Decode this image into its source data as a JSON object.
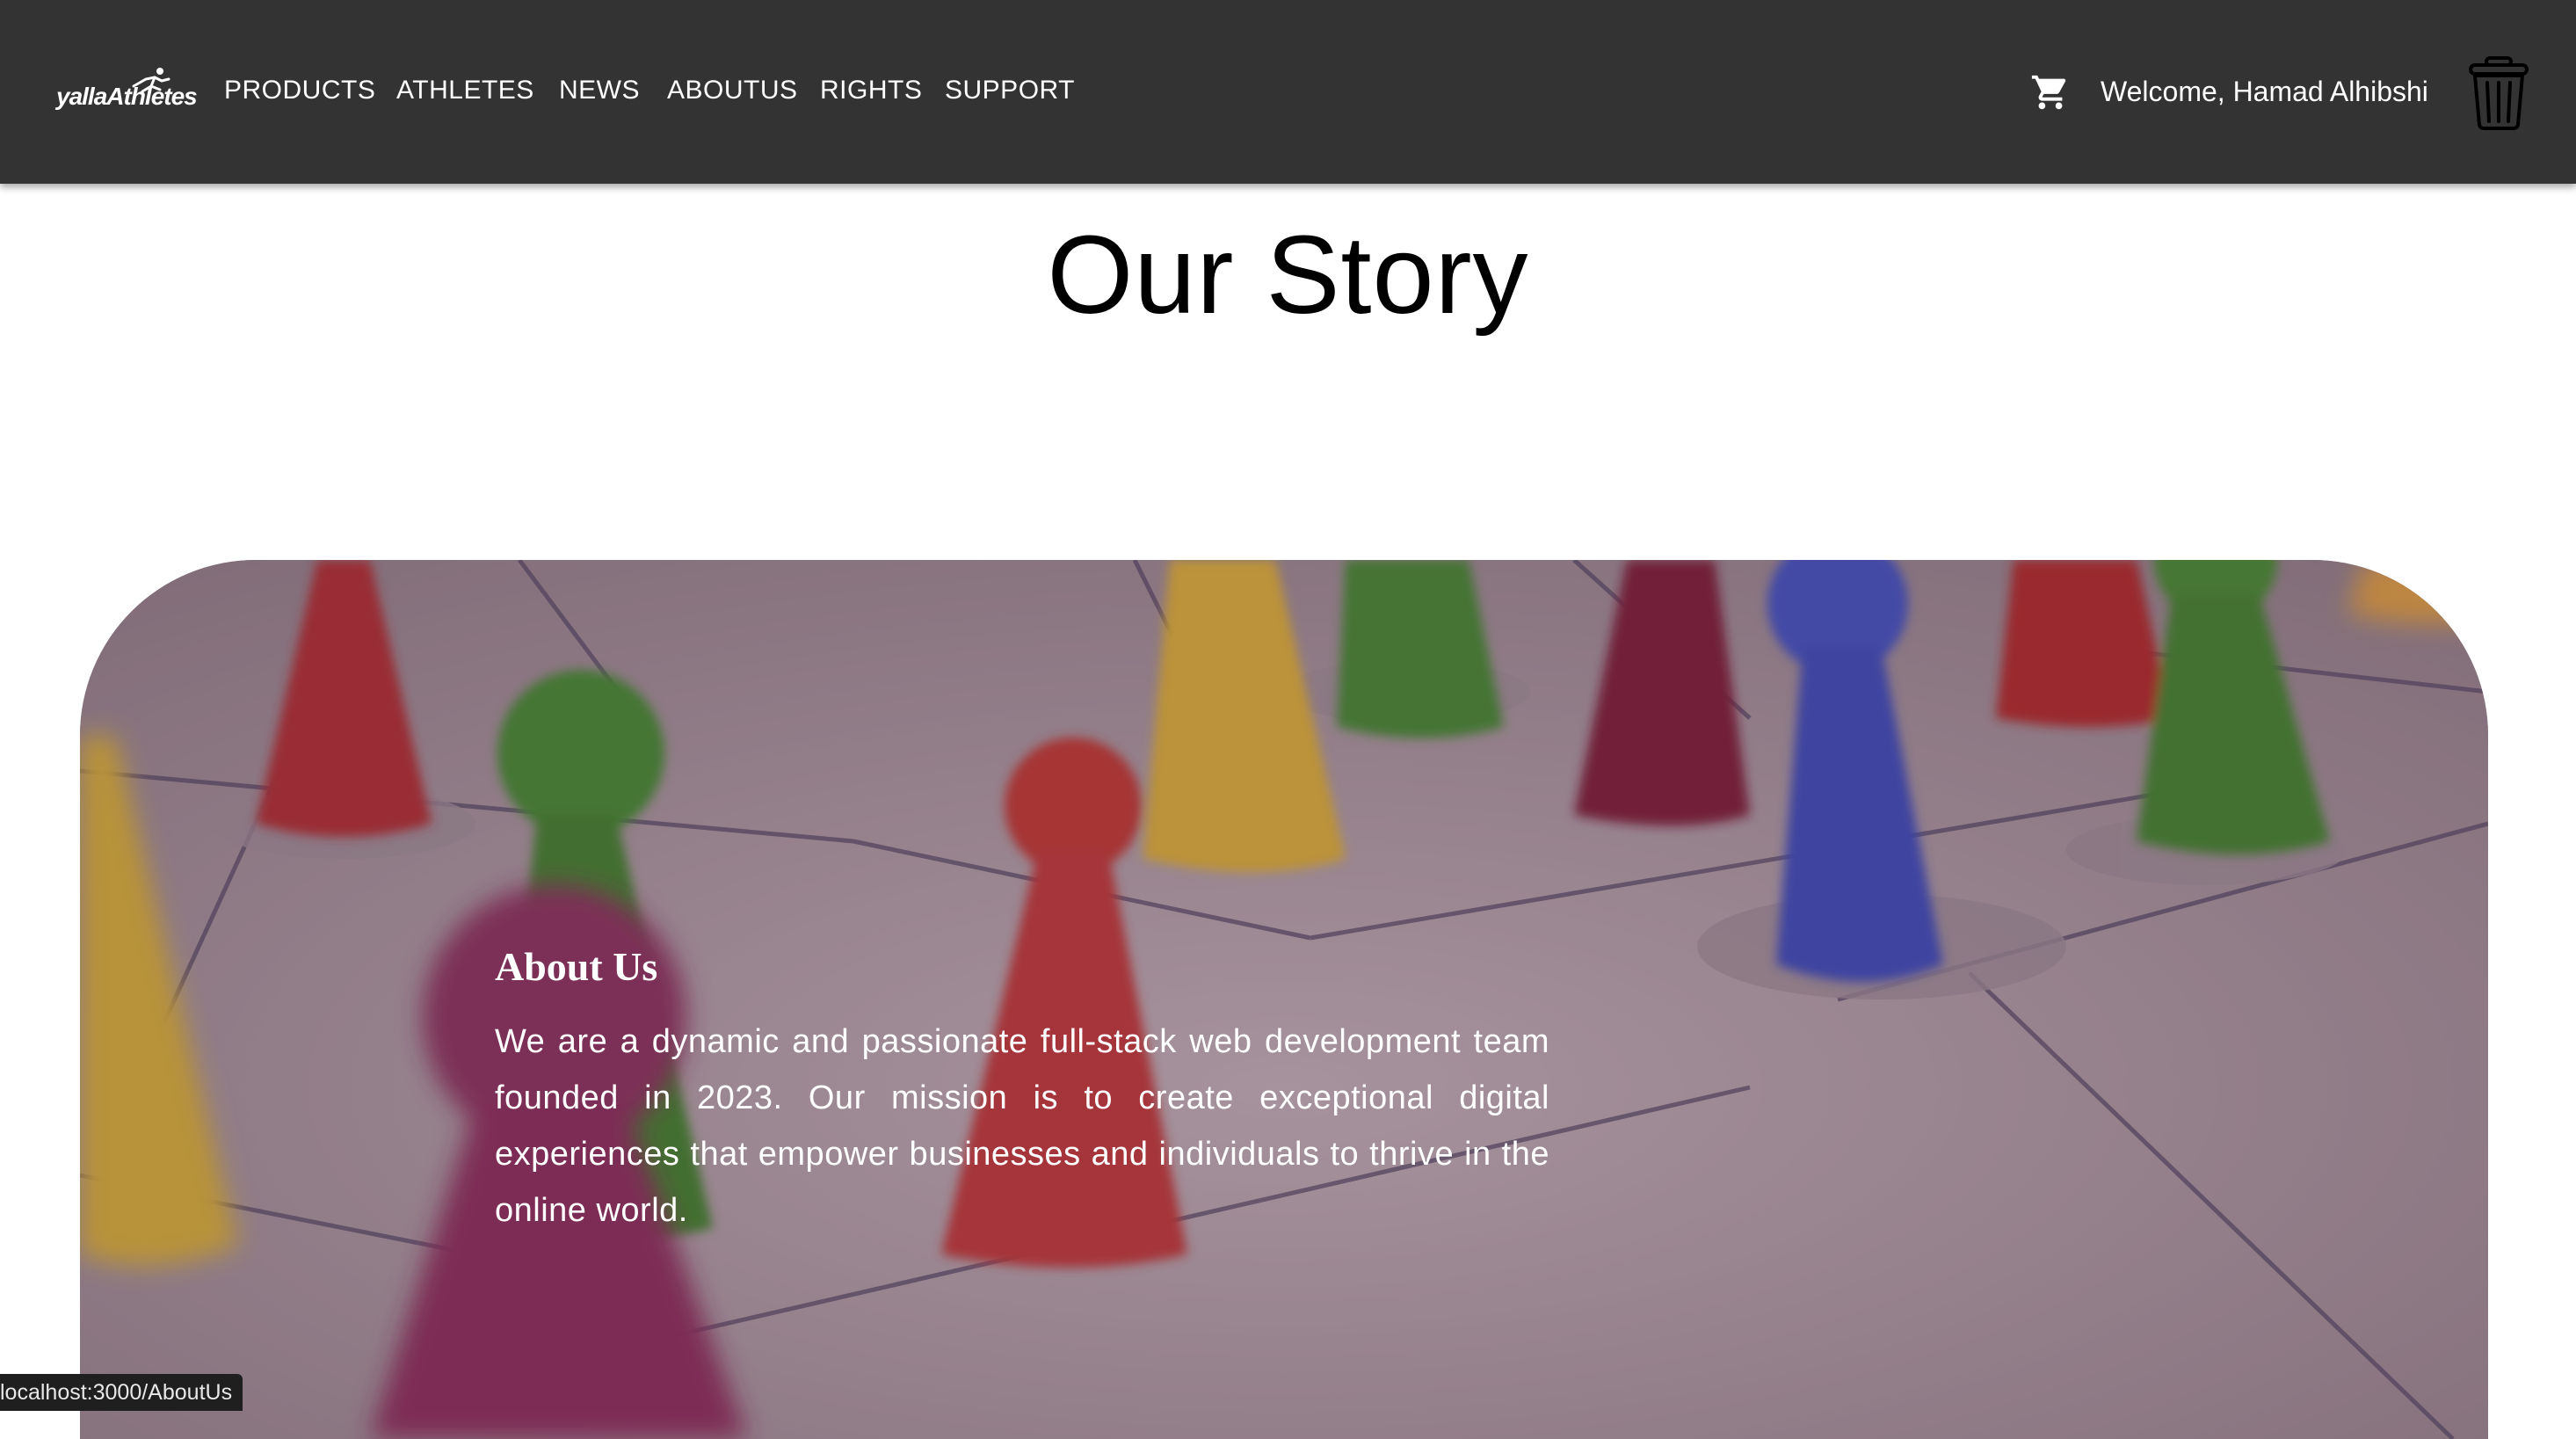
{
  "brand": {
    "logo_text": "yallaAthletes"
  },
  "nav": {
    "items": [
      {
        "label": "PRODUCTS"
      },
      {
        "label": "ATHLETES"
      },
      {
        "label": "NEWS"
      },
      {
        "label": "ABOUTUS"
      },
      {
        "label": "RIGHTS"
      },
      {
        "label": "SUPPORT"
      }
    ]
  },
  "user": {
    "welcome": "Welcome, Hamad Alhibshi"
  },
  "icons": {
    "cart": "cart-icon",
    "trash": "trash-icon",
    "logo": "runner-icon"
  },
  "page": {
    "title": "Our Story"
  },
  "about": {
    "heading": "About Us",
    "body": "We are a dynamic and passionate full-stack web development team founded in 2023. Our mission is to create exceptional digital experiences that empower businesses and individuals to thrive in the online world."
  },
  "status": {
    "url": "localhost:3000/AboutUs"
  },
  "colors": {
    "navbar": "#333333",
    "text_light": "#ffffff",
    "background": "#ffffff"
  }
}
